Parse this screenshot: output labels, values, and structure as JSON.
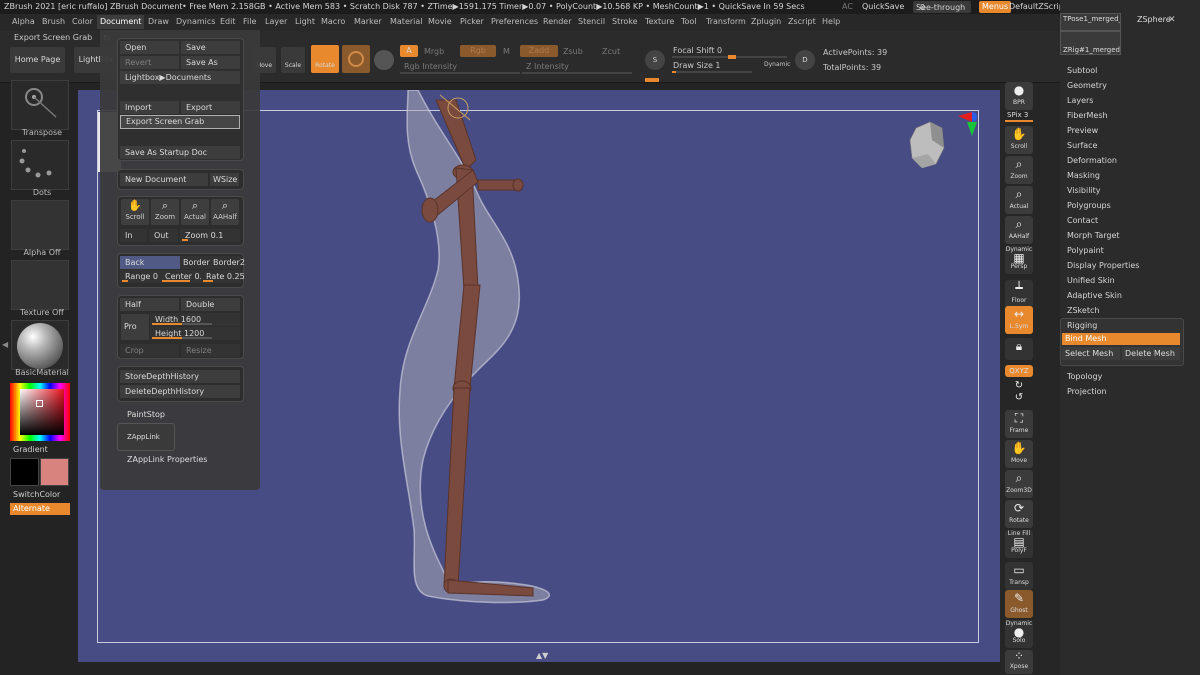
{
  "titlebar": {
    "app_title": "ZBrush 2021 [eric ruffalo]",
    "document_name": "ZBrush Document",
    "stats": "• Free Mem 2.158GB • Active Mem 583 • Scratch Disk 787 • ZTime▶1591.175 Timer▶0.07 • PolyCount▶10.568 KP • MeshCount▶1 • QuickSave In 59 Secs",
    "ac": "AC",
    "quicksave": "QuickSave",
    "see_through": "See-through",
    "see_through_value": "0",
    "menus": "Menus",
    "script": "DefaultZScript"
  },
  "menubar": [
    "Alpha",
    "Brush",
    "Color",
    "Document",
    "Draw",
    "Dynamics",
    "Edit",
    "File",
    "Layer",
    "Light",
    "Macro",
    "Marker",
    "Material",
    "Movie",
    "Picker",
    "Preferences",
    "Render",
    "Stencil",
    "Stroke",
    "Texture",
    "Tool",
    "Transform",
    "Zplugin",
    "Zscript",
    "Help"
  ],
  "menubar_active": "Document",
  "shelf": {
    "export_screen_grab": "Export Screen Grab",
    "home_page": "Home Page",
    "lightbox": "LightBox",
    "move": "Move",
    "scale": "Scale",
    "rotate": "Rotate",
    "a": "A",
    "mrgb": "Mrgb",
    "rgb": "Rgb",
    "m": "M",
    "zadd": "Zadd",
    "zsub": "Zsub",
    "zcut": "Zcut",
    "rgb_intensity": "Rgb Intensity",
    "z_intensity": "Z Intensity",
    "focal_shift": "Focal Shift 0",
    "draw_size": "Draw Size 1",
    "dynamic": "Dynamic",
    "active_points": "ActivePoints: 39",
    "total_points": "TotalPoints: 39",
    "s_label": "S",
    "d_label": "D"
  },
  "document_menu": {
    "open": "Open",
    "save": "Save",
    "revert": "Revert",
    "save_as": "Save As",
    "lightbox_documents": "Lightbox▶Documents",
    "import": "Import",
    "export": "Export",
    "export_screen_grab": "Export Screen Grab",
    "save_as_startup_doc": "Save As Startup Doc",
    "new_document": "New Document",
    "wsize": "WSize",
    "scroll": "Scroll",
    "zoom_btn": "Zoom",
    "actual": "Actual",
    "aahalf": "AAHalf",
    "in": "In",
    "out": "Out",
    "zoom_value": "Zoom 0.1",
    "back": "Back",
    "border": "Border",
    "border2": "Border2",
    "range": "Range 0",
    "center": "Center 0.7",
    "rate": "Rate 0.25",
    "half": "Half",
    "double": "Double",
    "pro": "Pro",
    "width": "Width 1600",
    "height": "Height 1200",
    "crop": "Crop",
    "resize": "Resize",
    "store_depth_history": "StoreDepthHistory",
    "delete_depth_history": "DeleteDepthHistory",
    "paint_stop": "PaintStop",
    "zapplink": "ZAppLink",
    "zapplink_properties": "ZAppLink Properties"
  },
  "left_tray": {
    "transpose": "Transpose",
    "dots": "Dots",
    "alpha_off": "Alpha Off",
    "texture_off": "Texture Off",
    "basic_material": "BasicMaterial",
    "gradient": "Gradient",
    "switch_color": "SwitchColor",
    "alternate": "Alternate",
    "secondary_color": "#d9837f"
  },
  "right_toolbar": {
    "bpr": "BPR",
    "spix": "SPix 3",
    "scroll": "Scroll",
    "zoom": "Zoom",
    "actual": "Actual",
    "aahalf": "AAHalf",
    "dynamic": "Dynamic",
    "persp": "Persp",
    "floor": "Floor",
    "lsym": "L.Sym",
    "qxyz": "QXYZ",
    "frame": "Frame",
    "move": "Move",
    "zoom3d": "Zoom3D",
    "rotate": "Rotate",
    "line_fill": "Line Fill",
    "polyf": "PolyF",
    "transp": "Transp",
    "ghost": "Ghost",
    "dynamic2": "Dynamic",
    "solo": "Solo",
    "xpose": "Xpose"
  },
  "right_panel": {
    "tool_thumb_1": "TPose1_merged_",
    "tool_thumb_2": "ZSphere",
    "tool_thumb_3": "ZRig#1_merged_",
    "items": [
      "Subtool",
      "Geometry",
      "Layers",
      "FiberMesh",
      "Preview",
      "Surface",
      "Deformation",
      "Masking",
      "Visibility",
      "Polygroups",
      "Contact",
      "Morph Target",
      "Polypaint",
      "Display Properties",
      "Unified Skin",
      "Adaptive Skin",
      "ZSketch"
    ],
    "rigging": "Rigging",
    "bind_mesh": "Bind Mesh",
    "select_mesh": "Select Mesh",
    "delete_mesh": "Delete Mesh",
    "topology": "Topology",
    "projection": "Projection"
  },
  "colors": {
    "accent": "#e8892d",
    "viewport": "#484c85",
    "highlight": "#505a85"
  }
}
